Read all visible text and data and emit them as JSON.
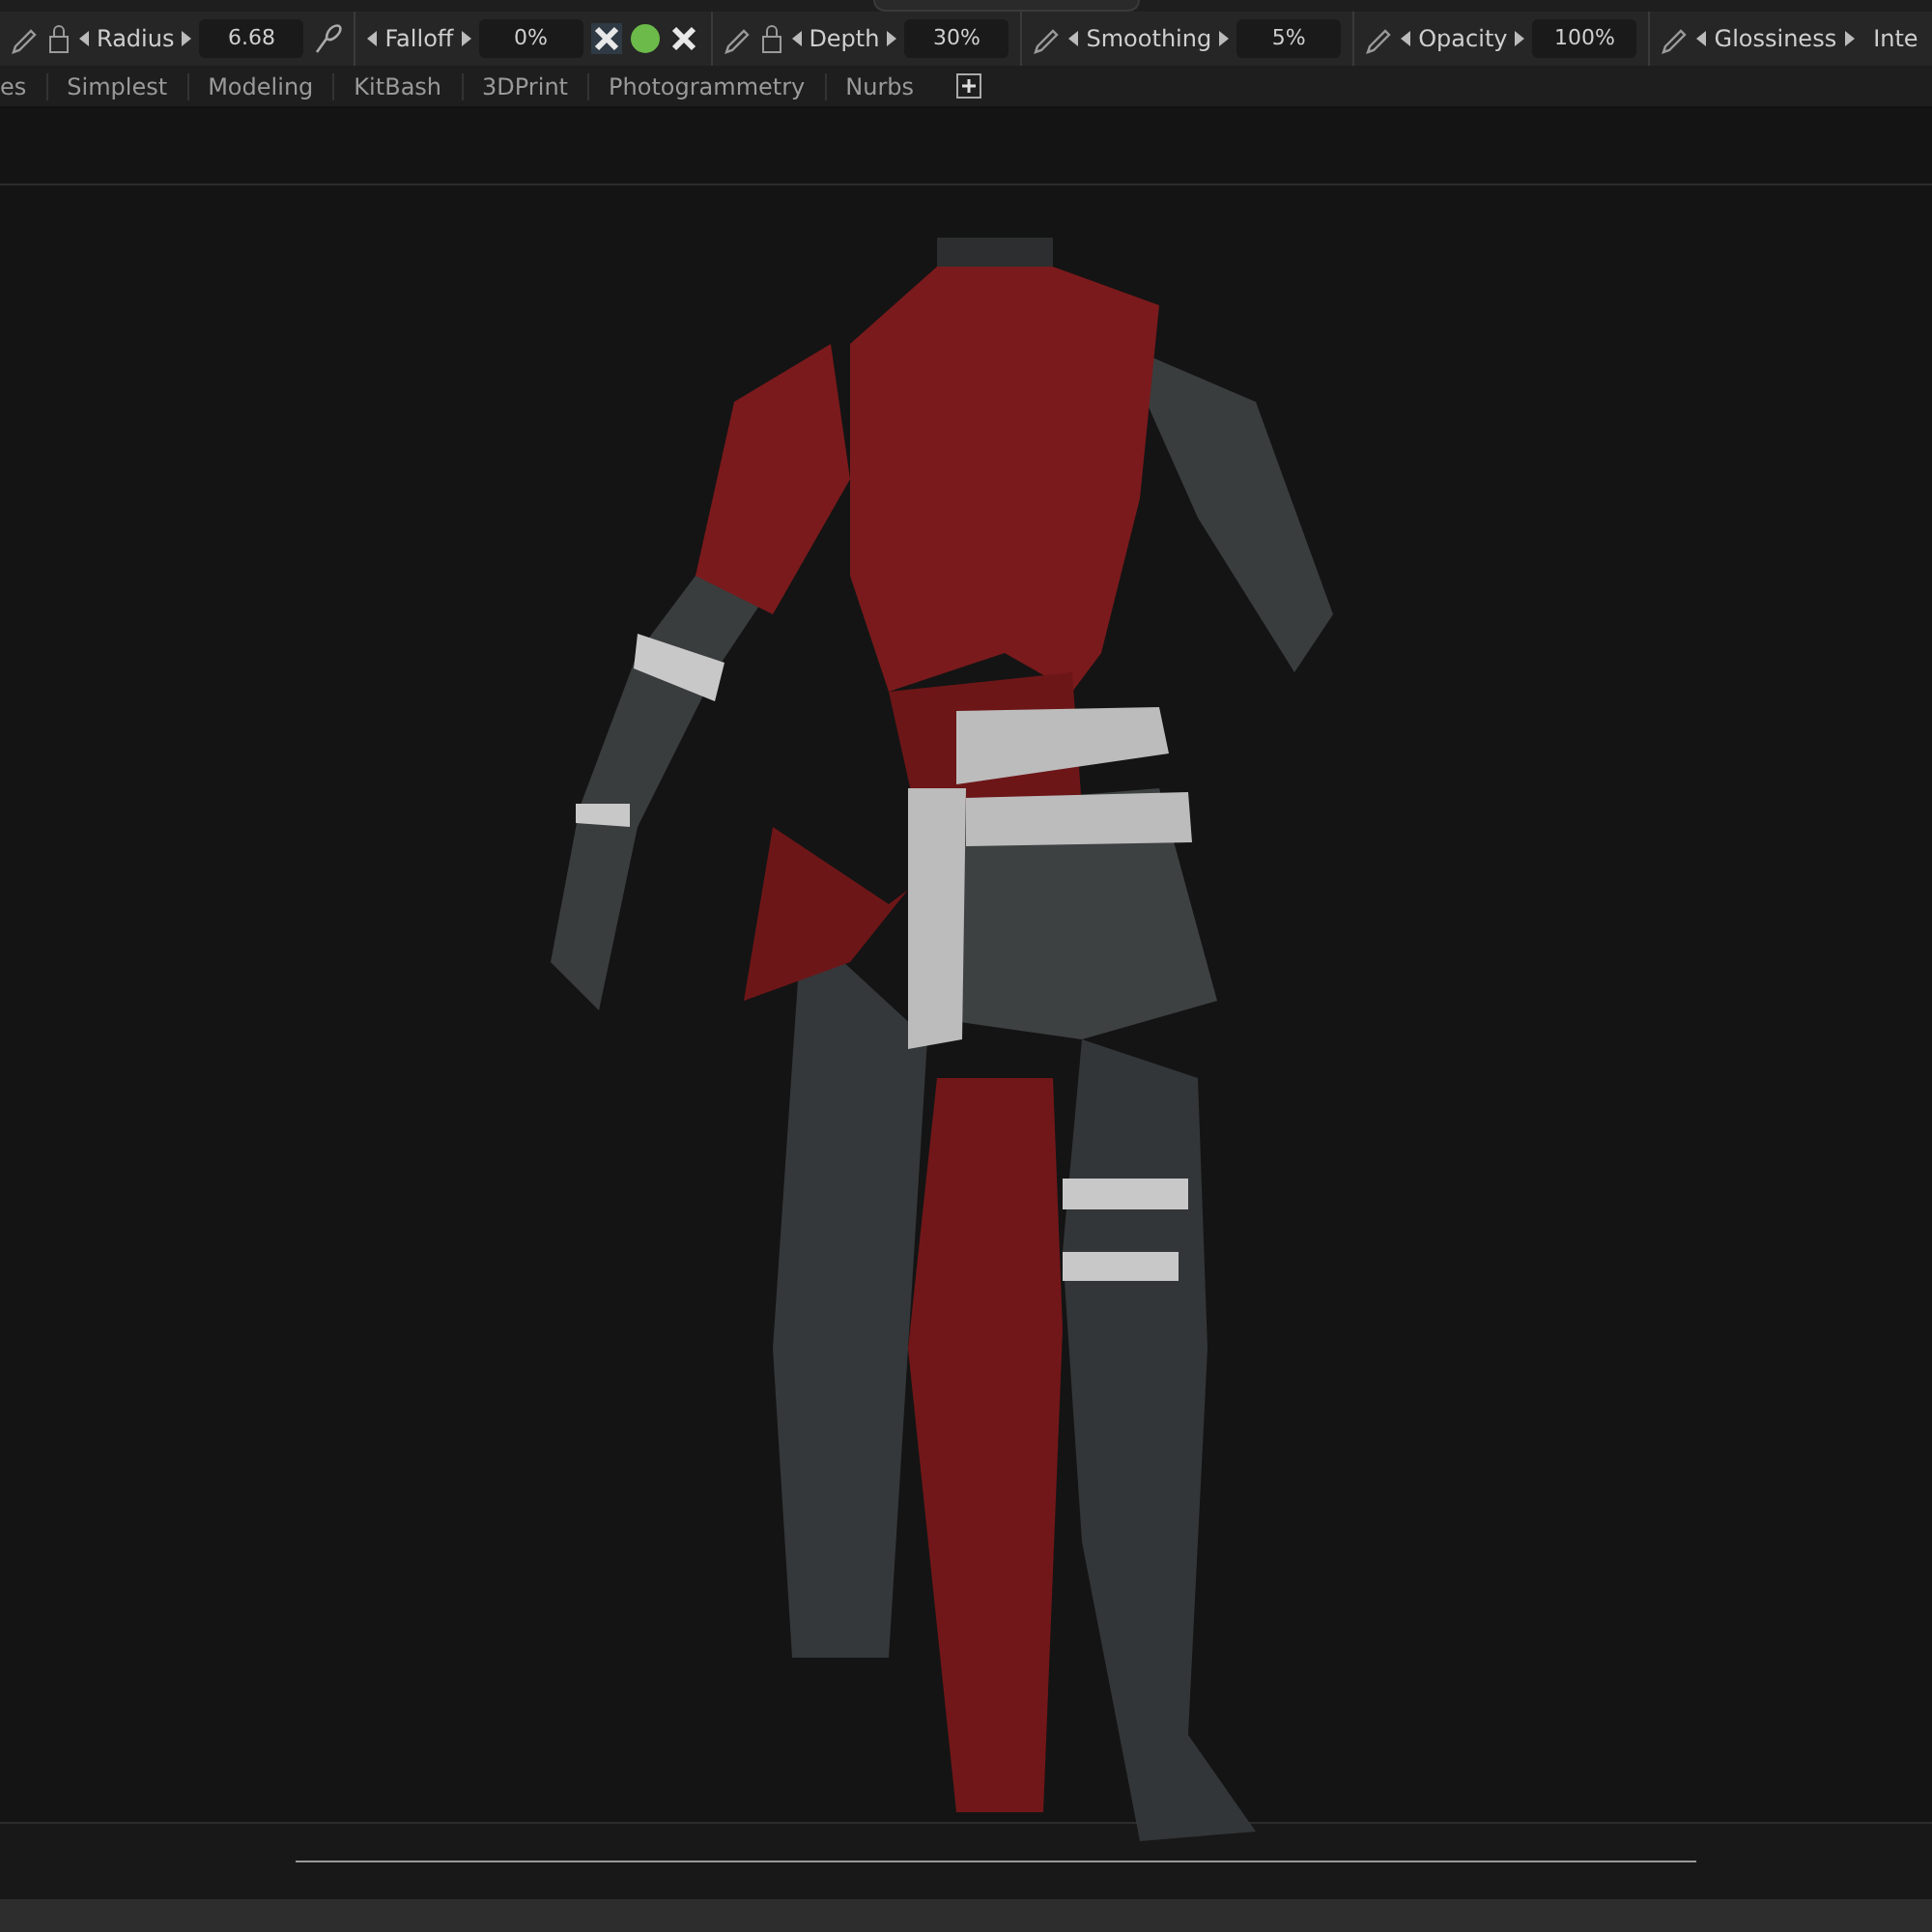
{
  "toolbar": {
    "items": [
      {
        "kind": "pencil-lock",
        "label": "Radius",
        "value": "6.68",
        "brush": true
      },
      {
        "kind": "plain",
        "label": "Falloff",
        "value": "0%",
        "toggles": true
      },
      {
        "kind": "pencil-lock",
        "label": "Depth",
        "value": "30%"
      },
      {
        "kind": "pencil",
        "label": "Smoothing",
        "value": "5%"
      },
      {
        "kind": "pencil",
        "label": "Opacity",
        "value": "100%"
      },
      {
        "kind": "pencil",
        "label": "Glossiness",
        "trailing": "Inte"
      }
    ]
  },
  "menu": {
    "tabs": [
      "es",
      "Simplest",
      "Modeling",
      "KitBash",
      "3DPrint",
      "Photogrammetry",
      "Nurbs"
    ]
  }
}
